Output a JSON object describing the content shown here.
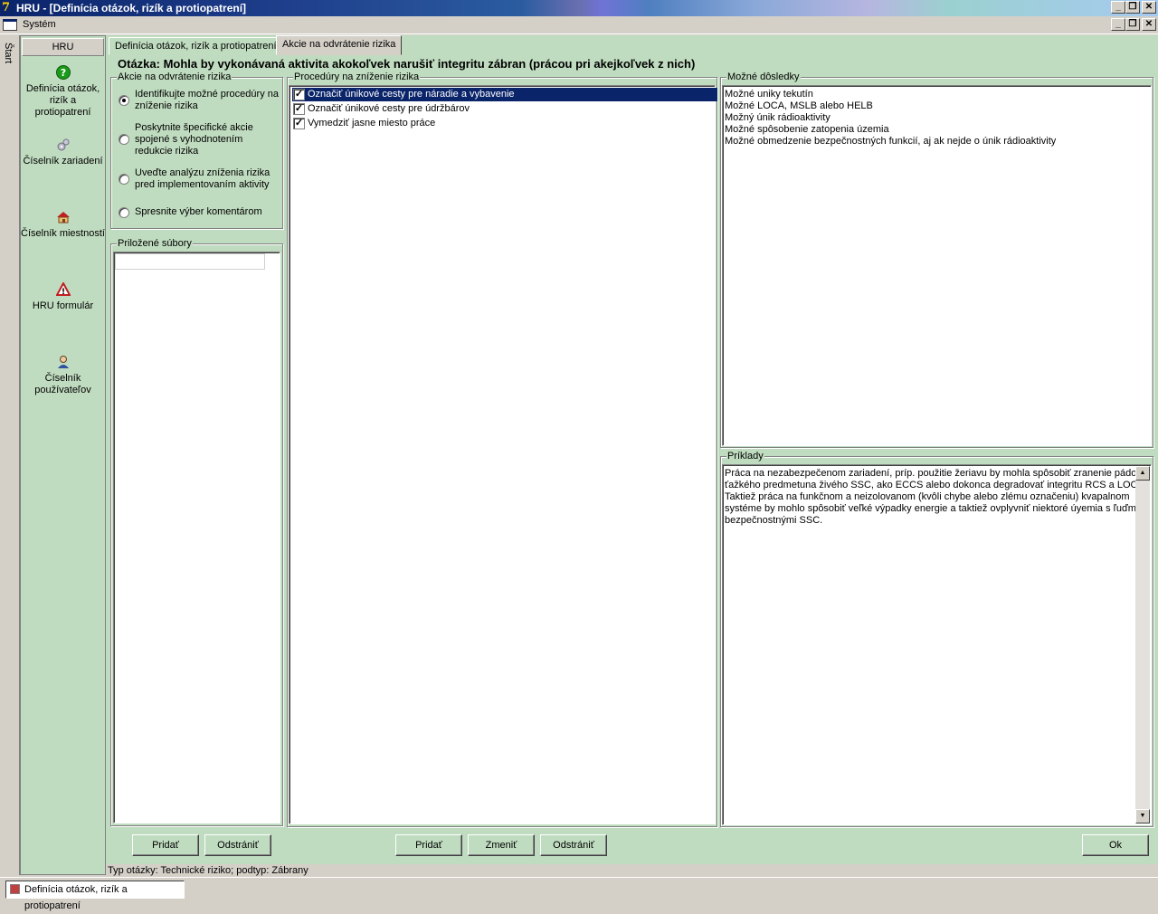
{
  "window": {
    "title": "HRU - [Definícia otázok, rizík a protiopatrení]",
    "app_icon": "7",
    "controls": [
      "_",
      "❐",
      "✕"
    ]
  },
  "menu": {
    "system": "Systém"
  },
  "start_strip": {
    "label": "Štart"
  },
  "nav": {
    "header": "HRU",
    "items": [
      {
        "label": "Definícia otázok, rizík a protiopatrení",
        "icon": "question-icon"
      },
      {
        "label": "Číselník zariadení",
        "icon": "gears-icon"
      },
      {
        "label": "Číselník miestností",
        "icon": "house-icon"
      },
      {
        "label": "HRU formulár",
        "icon": "warning-icon"
      },
      {
        "label": "Číselník používateľov",
        "icon": "user-icon"
      }
    ]
  },
  "tabs": [
    {
      "label": "Definícia otázok, rizík a protiopatrení",
      "active": false
    },
    {
      "label": "Akcie na odvrátenie rizika",
      "active": true
    }
  ],
  "question": "Otázka: Mohla by vykonávaná aktivita akokoľvek narušiť integritu zábran (prácou pri akejkoľvek z nich)",
  "actions_group": {
    "title": "Akcie na odvrátenie rizika",
    "options": [
      {
        "label": "Identifikujte možné procedúry na zníženie rizika",
        "selected": true
      },
      {
        "label": "Poskytnite špecifické akcie spojené s vyhodnotením redukcie rizika",
        "selected": false
      },
      {
        "label": "Uveďte analýzu zníženia rizika pred implementovaním aktivity",
        "selected": false
      },
      {
        "label": "Spresnite výber komentárom",
        "selected": false
      }
    ]
  },
  "attachments": {
    "title": "Priložené súbory",
    "input_value": ""
  },
  "procedures": {
    "title": "Procedúry na zníženie rizika",
    "items": [
      {
        "label": "Označiť únikové cesty pre náradie a vybavenie",
        "checked": true,
        "selected": true
      },
      {
        "label": "Označiť únikové cesty pre údržbárov",
        "checked": true,
        "selected": false
      },
      {
        "label": "Vymedziť jasne miesto práce",
        "checked": true,
        "selected": false
      }
    ]
  },
  "consequences": {
    "title": "Možné dôsledky",
    "items": [
      "Možné uniky tekutín",
      "Možné LOCA, MSLB alebo HELB",
      "Možný únik rádioaktivity",
      "Možné spôsobenie zatopenia územia",
      "Možné obmedzenie bezpečnostných funkcií, aj ak nejde o únik rádioaktivity"
    ]
  },
  "examples": {
    "title": "Príklady",
    "lines": [
      "Práca na nezabezpečenom zariadení, príp. použitie žeriavu by mohla spôsobiť zranenie pádom",
      "ťažkého predmetuna živého SSC, ako ECCS alebo dokonca degradovať integritu RCS a LOCA.",
      "Taktiež práca na funkčnom a neizolovanom (kvôli chybe alebo zlému označeniu) kvapalnom",
      "systéme by mohlo spôsobiť veľké výpadky energie a taktiež ovplyvniť niektoré úyemia s ľuďmi a",
      "bezpečnostnými SSC."
    ]
  },
  "buttons": {
    "attach_add": "Pridať",
    "attach_remove": "Odstrániť",
    "proc_add": "Pridať",
    "proc_change": "Zmeniť",
    "proc_remove": "Odstrániť",
    "ok": "Ok"
  },
  "status": "Typ otázky: Technické riziko; podtyp: Zábrany",
  "taskbar": {
    "task": "Definícia otázok, rizík a protiopatrení"
  }
}
